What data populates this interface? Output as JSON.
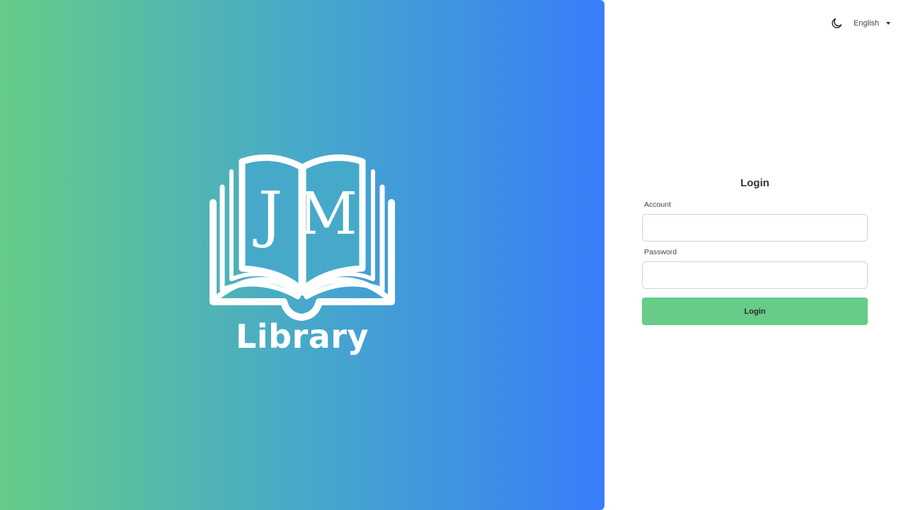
{
  "brand": {
    "name": "Library",
    "monogram_left": "J",
    "monogram_right": "M",
    "gradient": [
      "#66cc88",
      "#397dfa"
    ]
  },
  "topbar": {
    "theme_icon": "moon-icon",
    "language": "English",
    "language_icon": "caret-down-icon"
  },
  "login": {
    "title": "Login",
    "account_label": "Account",
    "account_value": "",
    "account_placeholder": "",
    "password_label": "Password",
    "password_value": "",
    "password_placeholder": "",
    "submit_label": "Login",
    "accent": "#66cc88"
  }
}
